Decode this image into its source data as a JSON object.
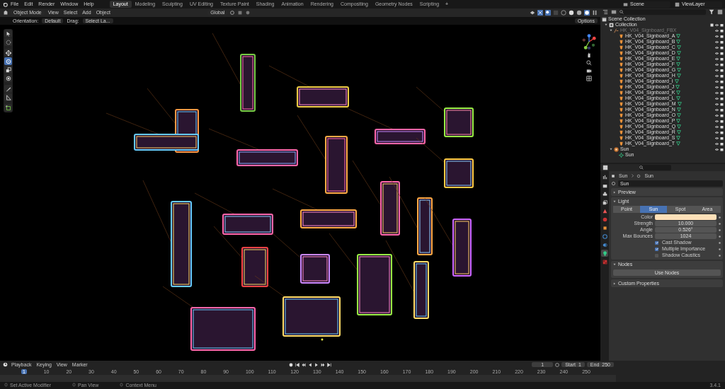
{
  "menu": [
    "File",
    "Edit",
    "Render",
    "Window",
    "Help"
  ],
  "workspaces": [
    {
      "label": "Layout",
      "selected": true
    },
    {
      "label": "Modeling",
      "selected": false
    },
    {
      "label": "Sculpting",
      "selected": false
    },
    {
      "label": "UV Editing",
      "selected": false
    },
    {
      "label": "Texture Paint",
      "selected": false
    },
    {
      "label": "Shading",
      "selected": false
    },
    {
      "label": "Animation",
      "selected": false
    },
    {
      "label": "Rendering",
      "selected": false
    },
    {
      "label": "Compositing",
      "selected": false
    },
    {
      "label": "Geometry Nodes",
      "selected": false
    },
    {
      "label": "Scripting",
      "selected": false
    }
  ],
  "add_workspace": "+",
  "scene": "Scene",
  "view_layer": "ViewLayer",
  "viewport": {
    "mode": "Object Mode",
    "menus": [
      "View",
      "Select",
      "Add",
      "Object"
    ],
    "transform": "Global",
    "orientation_label": "Orientation:",
    "orientation": "Default",
    "drag_label": "Drag:",
    "drag": "Select La...",
    "options": "Options",
    "tools": [
      {
        "kind": "select",
        "selected": false
      },
      {
        "kind": "cursor",
        "selected": false
      },
      {
        "kind": "move",
        "selected": false
      },
      {
        "kind": "rotate",
        "selected": true
      },
      {
        "kind": "scale",
        "selected": false
      },
      {
        "kind": "transform",
        "selected": false
      },
      {
        "kind": "annotate",
        "selected": false
      },
      {
        "kind": "measure",
        "selected": false
      },
      {
        "kind": "add",
        "selected": false
      }
    ]
  },
  "outliner": {
    "root": "Scene Collection",
    "items": [
      {
        "kind": "collection",
        "label": "Collection",
        "children": [
          {
            "kind": "empty",
            "label": "HK_V04_Signboard_FBX",
            "children": [
              {
                "kind": "mesh",
                "label": "HK_V04_Signboard_A"
              },
              {
                "kind": "mesh",
                "label": "HK_V04_Signboard_B"
              },
              {
                "kind": "mesh",
                "label": "HK_V04_Signboard_C"
              },
              {
                "kind": "mesh",
                "label": "HK_V04_Signboard_D"
              },
              {
                "kind": "mesh",
                "label": "HK_V04_Signboard_E"
              },
              {
                "kind": "mesh",
                "label": "HK_V04_Signboard_F"
              },
              {
                "kind": "mesh",
                "label": "HK_V04_Signboard_G"
              },
              {
                "kind": "mesh",
                "label": "HK_V04_Signboard_H"
              },
              {
                "kind": "mesh",
                "label": "HK_V04_Signboard_I"
              },
              {
                "kind": "mesh",
                "label": "HK_V04_Signboard_J"
              },
              {
                "kind": "mesh",
                "label": "HK_V04_Signboard_K"
              },
              {
                "kind": "mesh",
                "label": "HK_V04_Signboard_L"
              },
              {
                "kind": "mesh",
                "label": "HK_V04_Signboard_M"
              },
              {
                "kind": "mesh",
                "label": "HK_V04_Signboard_N"
              },
              {
                "kind": "mesh",
                "label": "HK_V04_Signboard_O"
              },
              {
                "kind": "mesh",
                "label": "HK_V04_Signboard_P"
              },
              {
                "kind": "mesh",
                "label": "HK_V04_Signboard_Q"
              },
              {
                "kind": "mesh",
                "label": "HK_V04_Signboard_R"
              },
              {
                "kind": "mesh",
                "label": "HK_V04_Signboard_S"
              },
              {
                "kind": "mesh",
                "label": "HK_V04_Signboard_T"
              }
            ]
          },
          {
            "kind": "light",
            "label": "Sun",
            "children": [
              {
                "kind": "lightdata",
                "label": "Sun"
              }
            ]
          }
        ]
      }
    ]
  },
  "properties": {
    "tabs": [
      {
        "kind": "tool",
        "selected": false
      },
      {
        "kind": "render",
        "selected": false
      },
      {
        "kind": "output",
        "selected": false
      },
      {
        "kind": "viewlayer",
        "selected": false
      },
      {
        "kind": "scene",
        "selected": false
      },
      {
        "kind": "world",
        "selected": false
      },
      {
        "kind": "object",
        "selected": false
      },
      {
        "kind": "physics",
        "selected": false
      },
      {
        "kind": "constraints",
        "selected": false
      },
      {
        "kind": "data",
        "selected": true
      },
      {
        "kind": "texture",
        "selected": false
      }
    ],
    "breadcrumb": [
      "Sun",
      "Sun"
    ],
    "datablock": "Sun",
    "preview": {
      "label": "Preview",
      "expanded": false
    },
    "light": {
      "label": "Light",
      "expanded": true,
      "types": [
        {
          "label": "Point",
          "selected": false
        },
        {
          "label": "Sun",
          "selected": true
        },
        {
          "label": "Spot",
          "selected": false
        },
        {
          "label": "Area",
          "selected": false
        }
      ],
      "fields": [
        {
          "label": "Color",
          "kind": "color",
          "color": "#fde0b8"
        },
        {
          "label": "Strength",
          "kind": "number",
          "value": "10.000"
        },
        {
          "label": "Angle",
          "kind": "number",
          "value": "0.526°"
        },
        {
          "label": "Max Bounces",
          "kind": "number",
          "value": "1024"
        }
      ],
      "checks": [
        {
          "label": "Cast Shadow",
          "checked": true
        },
        {
          "label": "Multiple Importance",
          "checked": true
        },
        {
          "label": "Shadow Caustics",
          "checked": false
        }
      ]
    },
    "nodes": {
      "label": "Nodes",
      "expanded": true,
      "button": "Use Nodes"
    },
    "custom": {
      "label": "Custom Properties",
      "expanded": false
    }
  },
  "timeline": {
    "menus": [
      "Playback",
      "Keying",
      "View",
      "Marker"
    ],
    "current_frame": "1",
    "start_label": "Start",
    "start": "1",
    "end_label": "End",
    "end": "250",
    "ticks": [
      "1",
      "10",
      "20",
      "30",
      "40",
      "50",
      "60",
      "70",
      "80",
      "90",
      "100",
      "110",
      "120",
      "130",
      "140",
      "150",
      "160",
      "170",
      "180",
      "190",
      "200",
      "210",
      "220",
      "230",
      "240",
      "250"
    ]
  },
  "status_bar": {
    "hints": [
      "Set Active Modifier",
      "Pan View",
      "Context Menu"
    ],
    "version": "3.4.1"
  }
}
